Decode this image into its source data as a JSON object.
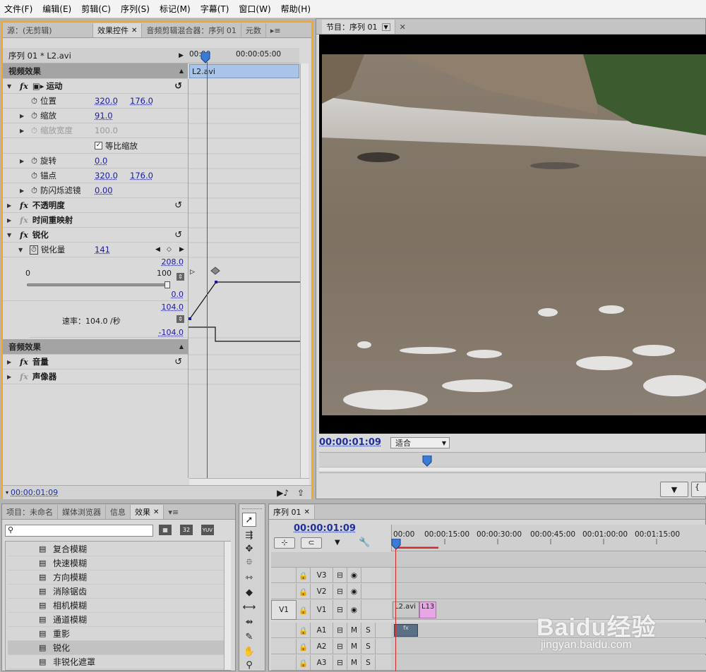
{
  "menu": [
    "文件(F)",
    "编辑(E)",
    "剪辑(C)",
    "序列(S)",
    "标记(M)",
    "字幕(T)",
    "窗口(W)",
    "帮助(H)"
  ],
  "source_panel": {
    "tabs": [
      {
        "label": "源：(无剪辑)"
      },
      {
        "label": "效果控件",
        "active": true
      },
      {
        "label": "音频剪辑混合器：序列 01"
      },
      {
        "label": "元数"
      }
    ],
    "clip_header": "序列 01 * L2.avi",
    "ruler_start": "00:00",
    "ruler_mid": "00:00:05:00",
    "clip_bar": "L2.avi",
    "timecode": "00:00:01:09",
    "rows": {
      "video_effects": "视频效果",
      "motion": "运动",
      "position": {
        "label": "位置",
        "x": "320.0",
        "y": "176.0"
      },
      "scale": {
        "label": "缩放",
        "value": "91.0"
      },
      "scale_width": {
        "label": "缩放宽度",
        "value": "100.0"
      },
      "uniform": {
        "label": "等比缩放"
      },
      "rotation": {
        "label": "旋转",
        "value": "0.0"
      },
      "anchor": {
        "label": "锚点",
        "x": "320.0",
        "y": "176.0"
      },
      "antiflicker": {
        "label": "防闪烁滤镜",
        "value": "0.00"
      },
      "opacity": "不透明度",
      "time_remap": "时间重映射",
      "sharpen": "锐化",
      "sharpen_amount": {
        "label": "锐化量",
        "value": "141"
      },
      "slider_min": "0",
      "slider_max": "100",
      "graph_top": "208.0",
      "graph_bottom": "0.0",
      "vel_top": "104.0",
      "vel_bottom": "-104.0",
      "speed": "速率：104.0 /秒",
      "audio_effects": "音频效果",
      "volume": "音量",
      "channel": "声像器"
    }
  },
  "program_panel": {
    "tab": "节目：序列 01",
    "timecode": "00:00:01:09",
    "fit": "适合"
  },
  "effects_panel": {
    "tabs": [
      {
        "label": "项目：未命名"
      },
      {
        "label": "媒体浏览器"
      },
      {
        "label": "信息"
      },
      {
        "label": "效果",
        "active": true
      }
    ],
    "search_placeholder": "",
    "badge_32": "32",
    "badge_yuv": "YUV",
    "items": [
      "复合模糊",
      "快速模糊",
      "方向模糊",
      "消除锯齿",
      "相机模糊",
      "通道模糊",
      "重影",
      "锐化",
      "非锐化遮罩"
    ],
    "selected_index": 7
  },
  "timeline": {
    "tab": "序列 01",
    "timecode": "00:00:01:09",
    "ruler": [
      "00:00",
      "00:00:15:00",
      "00:00:30:00",
      "00:00:45:00",
      "00:01:00:00",
      "00:01:15:00"
    ],
    "tracks": [
      {
        "label": "V3",
        "src": "",
        "type": "video"
      },
      {
        "label": "V2",
        "src": "",
        "type": "video"
      },
      {
        "label": "V1",
        "src": "V1",
        "type": "video"
      },
      {
        "label": "A1",
        "src": "",
        "type": "audio"
      },
      {
        "label": "A2",
        "src": "",
        "type": "audio"
      },
      {
        "label": "A3",
        "src": "",
        "type": "audio"
      }
    ],
    "m": "M",
    "s": "S",
    "clip1": "L2.avi",
    "clip2": "L13"
  },
  "watermark": {
    "brand": "Baidu经验",
    "url": "jingyan.baidu.com"
  },
  "colors": {
    "timecode": "#1d2f9e",
    "playhead": "#d22a2a",
    "clip": "#a9c4e6",
    "clip2": "#e7a7e7"
  }
}
